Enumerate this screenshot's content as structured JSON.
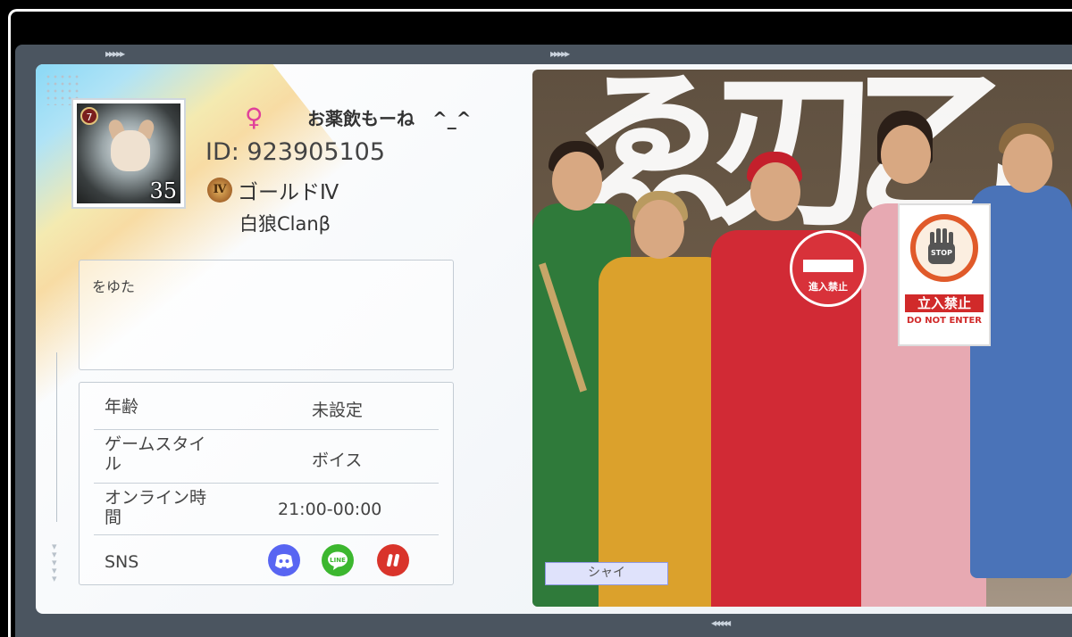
{
  "profile": {
    "name": "お薬飲もーね　^_^",
    "gender_icon": "female-sign",
    "id": "ID: 923905105",
    "rank": {
      "icon_text": "Ⅳ",
      "label": "ゴールドⅣ"
    },
    "clan": "白狼Clanβ",
    "avatar": {
      "badge": "7",
      "level": "35"
    }
  },
  "bio": "をゆた",
  "info": {
    "age_label": "年齢",
    "age_value": "未設定",
    "style_label_1": "ゲームスタイ",
    "style_label_2": "ル",
    "style_value": "ボイス",
    "online_label_1": "オンライン時",
    "online_label_2": "間",
    "online_value": "21:00-00:00",
    "sns_label": "SNS"
  },
  "sns": {
    "discord_color": "#5865f2",
    "line_color": "#3cb72f",
    "other_color": "#d9342b",
    "line_text": "LINE"
  },
  "photo": {
    "sign_text": "進入禁止",
    "stop_word": "STOP",
    "stop_jp": "立入禁止",
    "stop_en": "DO NOT ENTER",
    "caption": "シャイ"
  }
}
